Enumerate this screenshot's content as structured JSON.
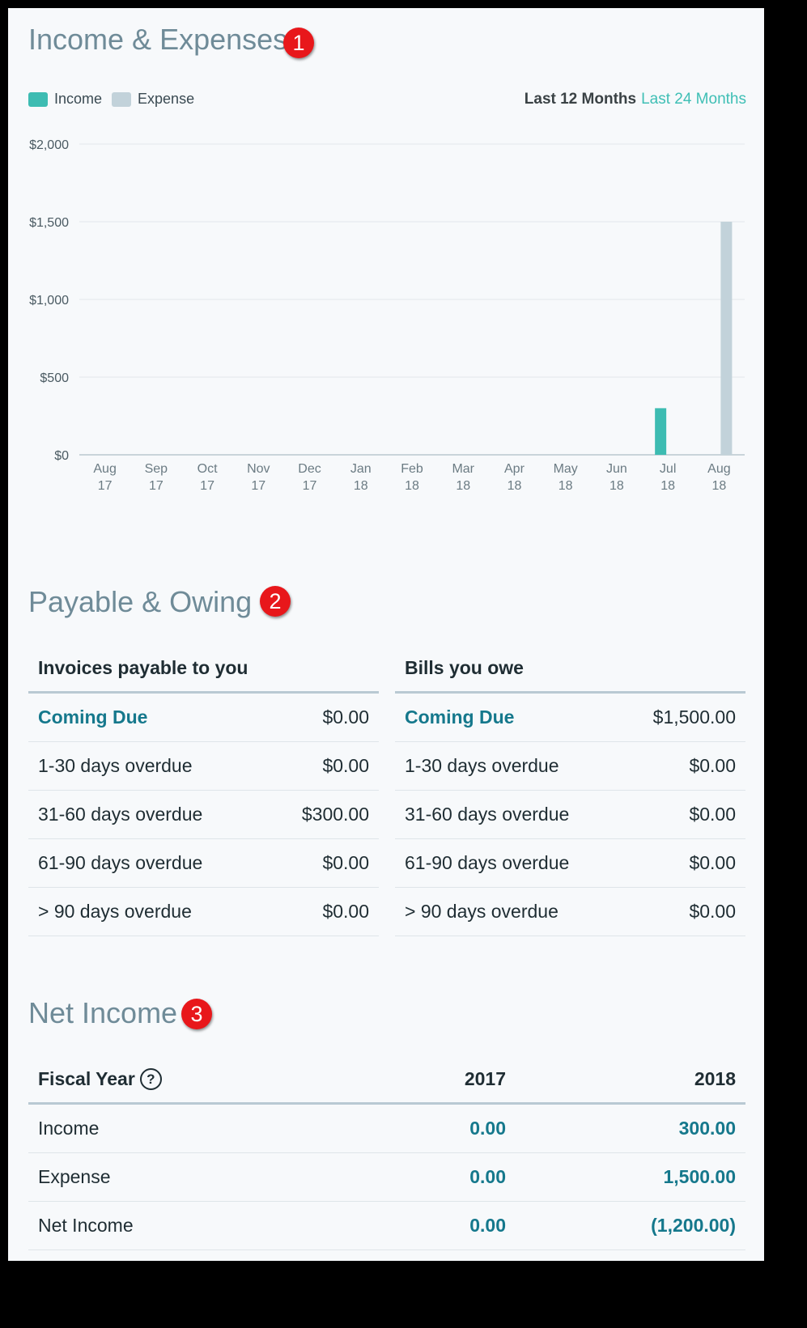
{
  "income_expenses": {
    "title": "Income & Expenses",
    "marker": "1",
    "legend": [
      {
        "label": "Income",
        "color": "#3dbcb2"
      },
      {
        "label": "Expense",
        "color": "#c2d2da"
      }
    ],
    "range_active": "Last 12 Months",
    "range_alt": "Last 24 Months"
  },
  "chart_data": {
    "type": "bar",
    "categories": [
      "Aug 17",
      "Sep 17",
      "Oct 17",
      "Nov 17",
      "Dec 17",
      "Jan 18",
      "Feb 18",
      "Mar 18",
      "Apr 18",
      "May 18",
      "Jun 18",
      "Jul 18",
      "Aug 18"
    ],
    "x_tick_lines": [
      [
        "Aug",
        "17"
      ],
      [
        "Sep",
        "17"
      ],
      [
        "Oct",
        "17"
      ],
      [
        "Nov",
        "17"
      ],
      [
        "Dec",
        "17"
      ],
      [
        "Jan",
        "18"
      ],
      [
        "Feb",
        "18"
      ],
      [
        "Mar",
        "18"
      ],
      [
        "Apr",
        "18"
      ],
      [
        "May",
        "18"
      ],
      [
        "Jun",
        "18"
      ],
      [
        "Jul",
        "18"
      ],
      [
        "Aug",
        "18"
      ]
    ],
    "series": [
      {
        "name": "Income",
        "color": "#3dbcb2",
        "values": [
          0,
          0,
          0,
          0,
          0,
          0,
          0,
          0,
          0,
          0,
          0,
          300,
          0
        ]
      },
      {
        "name": "Expense",
        "color": "#c2d2da",
        "values": [
          0,
          0,
          0,
          0,
          0,
          0,
          0,
          0,
          0,
          0,
          0,
          0,
          1500
        ]
      }
    ],
    "y_ticks": [
      0,
      500,
      1000,
      1500,
      2000
    ],
    "y_tick_labels": [
      "$0",
      "$500",
      "$1,000",
      "$1,500",
      "$2,000"
    ],
    "ylim": [
      0,
      2000
    ],
    "grid": true,
    "legend_position": "top-left"
  },
  "payable_owing": {
    "title": "Payable & Owing",
    "marker": "2",
    "invoices": {
      "heading": "Invoices payable to you",
      "rows": [
        {
          "label": "Coming Due",
          "amount": "$0.00"
        },
        {
          "label": "1-30 days overdue",
          "amount": "$0.00"
        },
        {
          "label": "31-60 days overdue",
          "amount": "$300.00"
        },
        {
          "label": "61-90 days overdue",
          "amount": "$0.00"
        },
        {
          "label": "> 90 days overdue",
          "amount": "$0.00"
        }
      ]
    },
    "bills": {
      "heading": "Bills you owe",
      "rows": [
        {
          "label": "Coming Due",
          "amount": "$1,500.00"
        },
        {
          "label": "1-30 days overdue",
          "amount": "$0.00"
        },
        {
          "label": "31-60 days overdue",
          "amount": "$0.00"
        },
        {
          "label": "61-90 days overdue",
          "amount": "$0.00"
        },
        {
          "label": "> 90 days overdue",
          "amount": "$0.00"
        }
      ]
    }
  },
  "net_income": {
    "title": "Net Income",
    "marker": "3",
    "header": {
      "label": "Fiscal Year",
      "help_icon": "?",
      "col1": "2017",
      "col2": "2018"
    },
    "rows": [
      {
        "label": "Income",
        "v2017": "0.00",
        "v2018": "300.00"
      },
      {
        "label": "Expense",
        "v2017": "0.00",
        "v2018": "1,500.00"
      },
      {
        "label": "Net Income",
        "v2017": "0.00",
        "v2018": "(1,200.00)"
      }
    ]
  }
}
